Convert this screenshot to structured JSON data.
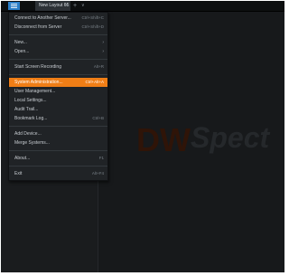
{
  "tabbar": {
    "tab_label": "New Layout 65",
    "tab_close": "×",
    "add_symbol": "+",
    "more_symbol": "∨"
  },
  "watermark": {
    "part1": "DW",
    "part2": "Spect"
  },
  "menu": {
    "groups": [
      [
        {
          "label": "Connect to Another Server...",
          "shortcut": "Ctrl+Shift+C"
        },
        {
          "label": "Disconnect from Server",
          "shortcut": "Ctrl+Shift+D"
        }
      ],
      [
        {
          "label": "New...",
          "submenu": true
        },
        {
          "label": "Open...",
          "submenu": true
        }
      ],
      [
        {
          "label": "Start Screen Recording",
          "shortcut": "Alt+R"
        }
      ],
      [
        {
          "label": "System Administration...",
          "shortcut": "Ctrl+Alt+A",
          "active": true
        },
        {
          "label": "User Management..."
        },
        {
          "label": "Local Settings..."
        },
        {
          "label": "Audit Trail..."
        },
        {
          "label": "Bookmark Log...",
          "shortcut": "Ctrl+B"
        }
      ],
      [
        {
          "label": "Add Device..."
        },
        {
          "label": "Merge Systems..."
        }
      ],
      [
        {
          "label": "About...",
          "shortcut": "F1"
        }
      ],
      [
        {
          "label": "Exit",
          "shortcut": "Alt+F4"
        }
      ]
    ]
  },
  "colors": {
    "active_item": "#f07e16",
    "menu_button": "#2a7fc9",
    "watermark": "#2f1408"
  }
}
